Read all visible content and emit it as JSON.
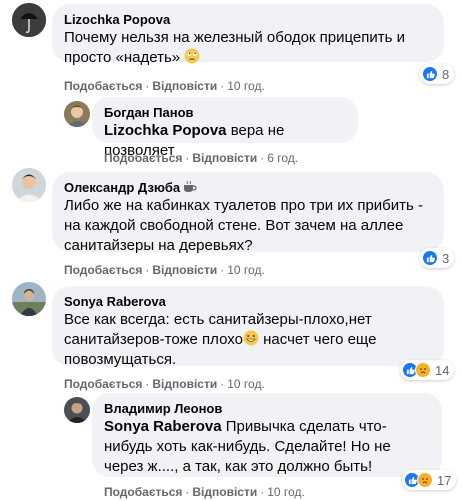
{
  "actions": {
    "like": "Подобається",
    "reply": "Відповісти",
    "dot": "·"
  },
  "comments": [
    {
      "author": "Lizochka Popova",
      "text": "Почему нельзя на железный ободок прицепить и просто «надеть»",
      "time": "10 год.",
      "reactions": {
        "count": "8",
        "types": [
          "like"
        ]
      },
      "avatar_icon": "umbrella-avatar"
    },
    {
      "author": "Богдан Панов",
      "mention": "Lizochka Popova",
      "text": " вера не позволяет",
      "time": "6 год.",
      "avatar_icon": "person-avatar"
    },
    {
      "author": "Олександр Дзюба",
      "text": "Либо же на кабинках туалетов про три их прибить - на каждой свободной стене. Вот зачем на аллее санитайзеры на деревьях?",
      "time": "10 год.",
      "reactions": {
        "count": "3",
        "types": [
          "like"
        ]
      },
      "avatar_icon": "person-avatar"
    },
    {
      "author": "Sonya Raberova",
      "text": "Все как всегда: есть санитайзеры-плохо,нет санитайзеров-тоже плохо",
      "text_after": " насчет чего еще повозмущаться.",
      "time": "10 год.",
      "reactions": {
        "count": "14",
        "types": [
          "like",
          "sad"
        ]
      },
      "avatar_icon": "person-avatar"
    },
    {
      "author": "Владимир Леонов",
      "mention": "Sonya Raberova",
      "text": " Привычка сделать что-нибудь хоть как-нибудь. Сделайте! Но не через ж...., а так, как это должно быть!",
      "time": "10 год.",
      "reactions": {
        "count": "17",
        "types": [
          "like",
          "sad"
        ]
      },
      "avatar_icon": "person-avatar"
    }
  ],
  "colors": {
    "bubble": "#f0f2f5",
    "meta": "#65676b",
    "like": "#1877f2"
  }
}
